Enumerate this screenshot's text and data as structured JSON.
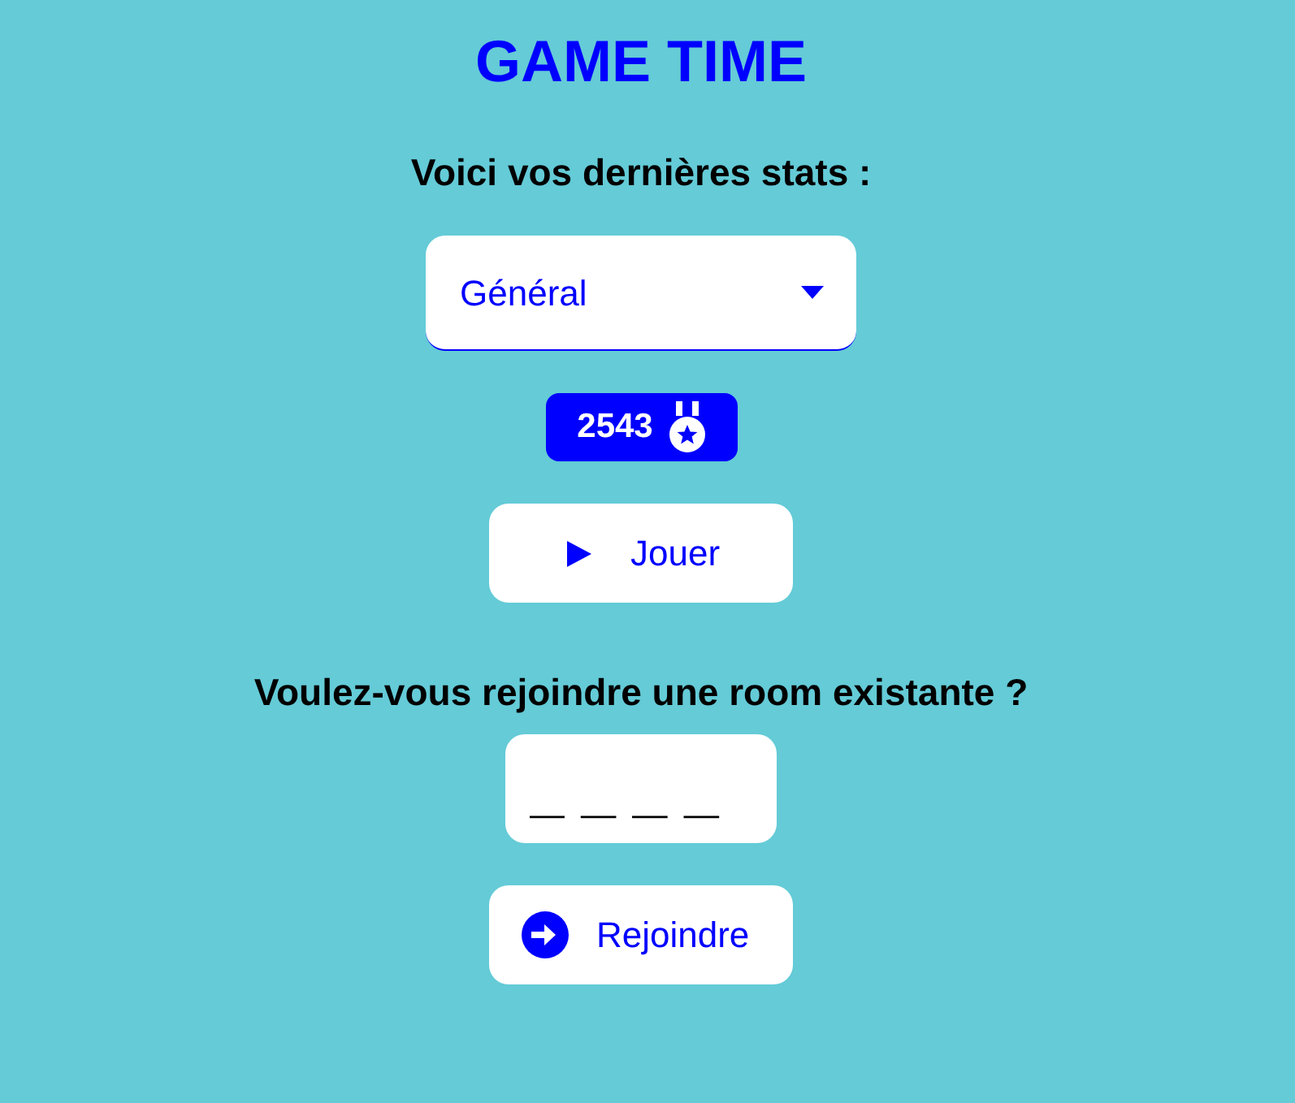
{
  "title": "GAME TIME",
  "stats": {
    "heading": "Voici vos dernières stats :",
    "mode_select": {
      "value": "Général"
    },
    "score": "2543"
  },
  "play_button": {
    "label": "Jouer"
  },
  "join": {
    "heading": "Voulez-vous rejoindre une room existante ?",
    "code_field": {
      "placeholder": "_ _ _ _"
    },
    "join_button": {
      "label": "Rejoindre"
    }
  }
}
